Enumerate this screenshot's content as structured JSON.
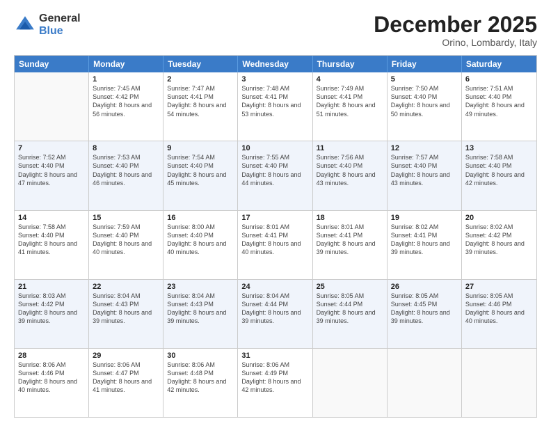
{
  "logo": {
    "general": "General",
    "blue": "Blue"
  },
  "title": "December 2025",
  "location": "Orino, Lombardy, Italy",
  "header_days": [
    "Sunday",
    "Monday",
    "Tuesday",
    "Wednesday",
    "Thursday",
    "Friday",
    "Saturday"
  ],
  "weeks": [
    {
      "alt": false,
      "cells": [
        {
          "day": "",
          "sunrise": "",
          "sunset": "",
          "daylight": ""
        },
        {
          "day": "1",
          "sunrise": "Sunrise: 7:45 AM",
          "sunset": "Sunset: 4:42 PM",
          "daylight": "Daylight: 8 hours and 56 minutes."
        },
        {
          "day": "2",
          "sunrise": "Sunrise: 7:47 AM",
          "sunset": "Sunset: 4:41 PM",
          "daylight": "Daylight: 8 hours and 54 minutes."
        },
        {
          "day": "3",
          "sunrise": "Sunrise: 7:48 AM",
          "sunset": "Sunset: 4:41 PM",
          "daylight": "Daylight: 8 hours and 53 minutes."
        },
        {
          "day": "4",
          "sunrise": "Sunrise: 7:49 AM",
          "sunset": "Sunset: 4:41 PM",
          "daylight": "Daylight: 8 hours and 51 minutes."
        },
        {
          "day": "5",
          "sunrise": "Sunrise: 7:50 AM",
          "sunset": "Sunset: 4:40 PM",
          "daylight": "Daylight: 8 hours and 50 minutes."
        },
        {
          "day": "6",
          "sunrise": "Sunrise: 7:51 AM",
          "sunset": "Sunset: 4:40 PM",
          "daylight": "Daylight: 8 hours and 49 minutes."
        }
      ]
    },
    {
      "alt": true,
      "cells": [
        {
          "day": "7",
          "sunrise": "Sunrise: 7:52 AM",
          "sunset": "Sunset: 4:40 PM",
          "daylight": "Daylight: 8 hours and 47 minutes."
        },
        {
          "day": "8",
          "sunrise": "Sunrise: 7:53 AM",
          "sunset": "Sunset: 4:40 PM",
          "daylight": "Daylight: 8 hours and 46 minutes."
        },
        {
          "day": "9",
          "sunrise": "Sunrise: 7:54 AM",
          "sunset": "Sunset: 4:40 PM",
          "daylight": "Daylight: 8 hours and 45 minutes."
        },
        {
          "day": "10",
          "sunrise": "Sunrise: 7:55 AM",
          "sunset": "Sunset: 4:40 PM",
          "daylight": "Daylight: 8 hours and 44 minutes."
        },
        {
          "day": "11",
          "sunrise": "Sunrise: 7:56 AM",
          "sunset": "Sunset: 4:40 PM",
          "daylight": "Daylight: 8 hours and 43 minutes."
        },
        {
          "day": "12",
          "sunrise": "Sunrise: 7:57 AM",
          "sunset": "Sunset: 4:40 PM",
          "daylight": "Daylight: 8 hours and 43 minutes."
        },
        {
          "day": "13",
          "sunrise": "Sunrise: 7:58 AM",
          "sunset": "Sunset: 4:40 PM",
          "daylight": "Daylight: 8 hours and 42 minutes."
        }
      ]
    },
    {
      "alt": false,
      "cells": [
        {
          "day": "14",
          "sunrise": "Sunrise: 7:58 AM",
          "sunset": "Sunset: 4:40 PM",
          "daylight": "Daylight: 8 hours and 41 minutes."
        },
        {
          "day": "15",
          "sunrise": "Sunrise: 7:59 AM",
          "sunset": "Sunset: 4:40 PM",
          "daylight": "Daylight: 8 hours and 40 minutes."
        },
        {
          "day": "16",
          "sunrise": "Sunrise: 8:00 AM",
          "sunset": "Sunset: 4:40 PM",
          "daylight": "Daylight: 8 hours and 40 minutes."
        },
        {
          "day": "17",
          "sunrise": "Sunrise: 8:01 AM",
          "sunset": "Sunset: 4:41 PM",
          "daylight": "Daylight: 8 hours and 40 minutes."
        },
        {
          "day": "18",
          "sunrise": "Sunrise: 8:01 AM",
          "sunset": "Sunset: 4:41 PM",
          "daylight": "Daylight: 8 hours and 39 minutes."
        },
        {
          "day": "19",
          "sunrise": "Sunrise: 8:02 AM",
          "sunset": "Sunset: 4:41 PM",
          "daylight": "Daylight: 8 hours and 39 minutes."
        },
        {
          "day": "20",
          "sunrise": "Sunrise: 8:02 AM",
          "sunset": "Sunset: 4:42 PM",
          "daylight": "Daylight: 8 hours and 39 minutes."
        }
      ]
    },
    {
      "alt": true,
      "cells": [
        {
          "day": "21",
          "sunrise": "Sunrise: 8:03 AM",
          "sunset": "Sunset: 4:42 PM",
          "daylight": "Daylight: 8 hours and 39 minutes."
        },
        {
          "day": "22",
          "sunrise": "Sunrise: 8:04 AM",
          "sunset": "Sunset: 4:43 PM",
          "daylight": "Daylight: 8 hours and 39 minutes."
        },
        {
          "day": "23",
          "sunrise": "Sunrise: 8:04 AM",
          "sunset": "Sunset: 4:43 PM",
          "daylight": "Daylight: 8 hours and 39 minutes."
        },
        {
          "day": "24",
          "sunrise": "Sunrise: 8:04 AM",
          "sunset": "Sunset: 4:44 PM",
          "daylight": "Daylight: 8 hours and 39 minutes."
        },
        {
          "day": "25",
          "sunrise": "Sunrise: 8:05 AM",
          "sunset": "Sunset: 4:44 PM",
          "daylight": "Daylight: 8 hours and 39 minutes."
        },
        {
          "day": "26",
          "sunrise": "Sunrise: 8:05 AM",
          "sunset": "Sunset: 4:45 PM",
          "daylight": "Daylight: 8 hours and 39 minutes."
        },
        {
          "day": "27",
          "sunrise": "Sunrise: 8:05 AM",
          "sunset": "Sunset: 4:46 PM",
          "daylight": "Daylight: 8 hours and 40 minutes."
        }
      ]
    },
    {
      "alt": false,
      "cells": [
        {
          "day": "28",
          "sunrise": "Sunrise: 8:06 AM",
          "sunset": "Sunset: 4:46 PM",
          "daylight": "Daylight: 8 hours and 40 minutes."
        },
        {
          "day": "29",
          "sunrise": "Sunrise: 8:06 AM",
          "sunset": "Sunset: 4:47 PM",
          "daylight": "Daylight: 8 hours and 41 minutes."
        },
        {
          "day": "30",
          "sunrise": "Sunrise: 8:06 AM",
          "sunset": "Sunset: 4:48 PM",
          "daylight": "Daylight: 8 hours and 42 minutes."
        },
        {
          "day": "31",
          "sunrise": "Sunrise: 8:06 AM",
          "sunset": "Sunset: 4:49 PM",
          "daylight": "Daylight: 8 hours and 42 minutes."
        },
        {
          "day": "",
          "sunrise": "",
          "sunset": "",
          "daylight": ""
        },
        {
          "day": "",
          "sunrise": "",
          "sunset": "",
          "daylight": ""
        },
        {
          "day": "",
          "sunrise": "",
          "sunset": "",
          "daylight": ""
        }
      ]
    }
  ]
}
